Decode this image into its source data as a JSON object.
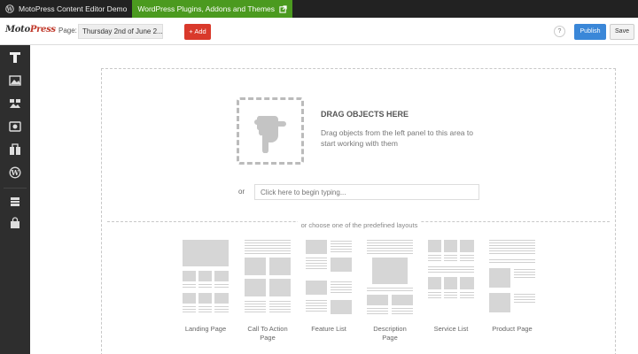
{
  "topbar": {
    "site_title": "MotoPress Content Editor Demo",
    "plugins_link": "WordPress Plugins, Addons and Themes"
  },
  "toolbar": {
    "logo_part1": "Moto",
    "logo_part2": "Press",
    "page_label": "Page:",
    "page_value": "Thursday 2nd of June 2...",
    "add_label": "+ Add",
    "help_label": "?",
    "publish_label": "Publish",
    "save_label": "Save"
  },
  "left_panel": {
    "icons": [
      "text-icon",
      "image-icon",
      "gallery-icon",
      "video-icon",
      "widget-icon",
      "wordpress-icon",
      "layout-icon",
      "bag-icon"
    ]
  },
  "canvas": {
    "drop_title": "DRAG OBJECTS HERE",
    "drop_description": "Drag objects from the left panel to this area to start working with them",
    "or_label": "or",
    "typing_placeholder": "Click here to begin typing...",
    "layouts_caption": "or choose one of the predefined layouts",
    "layouts": [
      {
        "name": "Landing Page"
      },
      {
        "name": "Call To Action Page"
      },
      {
        "name": "Feature List"
      },
      {
        "name": "Description Page"
      },
      {
        "name": "Service List"
      },
      {
        "name": "Product Page"
      }
    ]
  },
  "colors": {
    "accent_red": "#d9392b",
    "publish_blue": "#3a87d8",
    "plugins_green": "#4b9a1f",
    "topbar_bg": "#222222",
    "panel_bg": "#2e2e2e"
  }
}
